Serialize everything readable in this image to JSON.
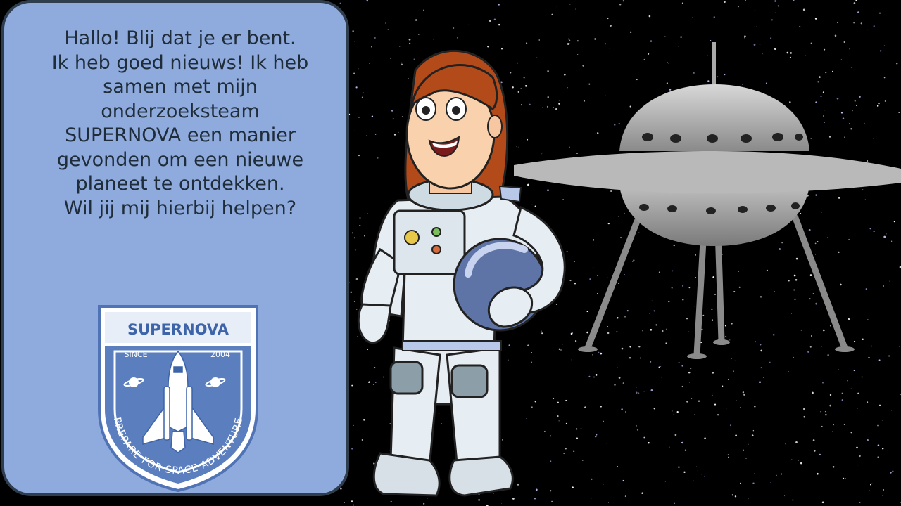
{
  "speech": {
    "lines": [
      "Hallo! Blij dat je er bent.",
      "Ik heb goed nieuws! Ik heb",
      "samen met mijn",
      "onderzoeksteam",
      "SUPERNOVA een manier",
      "gevonden om een nieuwe",
      "planeet te ontdekken."
    ],
    "question": "Wil jij mij hierbij helpen?"
  },
  "badge": {
    "title": "SUPERNOVA",
    "since_label": "SINCE",
    "year": "2004",
    "motto": "PREPARE FOR SPACE ADVENTURE"
  },
  "colors": {
    "bubble": "#8faadc",
    "bubble_border": "#2f3e4e",
    "badge_blue": "#4f73b4",
    "space": "#000000"
  },
  "icons": [
    "space-shuttle-icon",
    "planet-icon",
    "ufo-illustration",
    "astronaut-illustration"
  ]
}
